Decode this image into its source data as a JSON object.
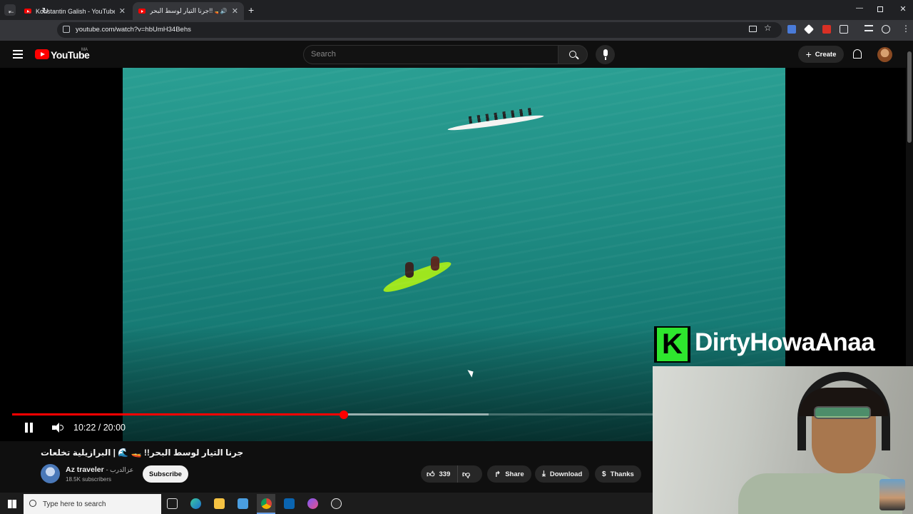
{
  "browser": {
    "tabs": [
      {
        "title": "Konstantin Galish - YouTube",
        "active": false
      },
      {
        "title": "جرنا التيار لوسط البحر!! 🚤 🌊",
        "active": true
      }
    ],
    "new_tab_symbol": "+",
    "url": "youtube.com/watch?v=hbUmH34Behs"
  },
  "youtube": {
    "logo_text": "YouTube",
    "country_code": "MA",
    "search_placeholder": "Search",
    "create_label": "Create"
  },
  "player": {
    "current_time": "10:22",
    "duration": "20:00",
    "time_display": "10:22 / 20:00",
    "progress_fraction": 0.5183,
    "buffered_fraction": 0.744,
    "state": "playing"
  },
  "overlay": {
    "brand_letter": "K",
    "brand_name": "DirtyHowaAnaa"
  },
  "video_info": {
    "title": "جرنا التيار لوسط البحر!! 🚤 🌊 | البرازيلية تخلعات",
    "channel_name": "Az traveler",
    "channel_name_ar": "- عزالدرب",
    "subscribers": "18.5K subscribers",
    "subscribe_label": "Subscribe",
    "likes": "339",
    "share_label": "Share",
    "download_label": "Download",
    "thanks_label": "Thanks"
  },
  "taskbar": {
    "search_placeholder": "Type here to search"
  },
  "colors": {
    "progress": "#ff0000",
    "yt_brand": "#ff0000",
    "background": "#0f0f0f",
    "water": "#1f8c83",
    "brand_green": "#2ee62e"
  }
}
